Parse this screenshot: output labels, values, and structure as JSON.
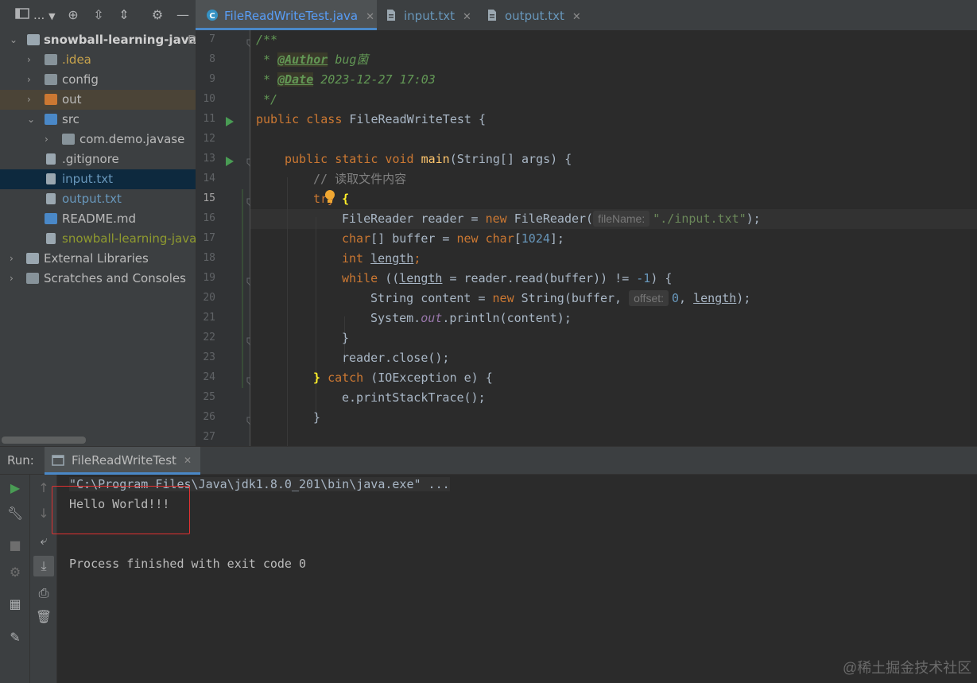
{
  "toolbar": {
    "project_dropdown": "...",
    "icons": [
      "project-view-icon",
      "locate-icon",
      "expand-all-icon",
      "collapse-all-icon",
      "settings-icon",
      "hide-icon"
    ]
  },
  "tabs": [
    {
      "label": "FileReadWriteTest.java",
      "active": true,
      "icon": "java-class-icon"
    },
    {
      "label": "input.txt",
      "active": false,
      "icon": "text-file-icon"
    },
    {
      "label": "output.txt",
      "active": false,
      "icon": "text-file-icon"
    }
  ],
  "tree": {
    "root": "snowball-learning-java",
    "root_suffix": "D",
    "items": [
      {
        "label": ".idea",
        "color": "#c7a34c"
      },
      {
        "label": "config",
        "color": "#bbbbbb"
      },
      {
        "label": "out",
        "color": "#bbbbbb"
      },
      {
        "label": "src",
        "color": "#bbbbbb"
      },
      {
        "label": "com.demo.javase",
        "color": "#bbbbbb"
      },
      {
        "label": ".gitignore",
        "color": "#bbbbbb"
      },
      {
        "label": "input.txt",
        "color": "#6897bb"
      },
      {
        "label": "output.txt",
        "color": "#6897bb"
      },
      {
        "label": "README.md",
        "color": "#bbbbbb"
      },
      {
        "label": "snowball-learning-java.",
        "color": "#8f9a2f"
      },
      {
        "label": "External Libraries",
        "color": "#bbbbbb"
      },
      {
        "label": "Scratches and Consoles",
        "color": "#bbbbbb"
      }
    ]
  },
  "editor": {
    "line_numbers": [
      "7",
      "8",
      "9",
      "10",
      "11",
      "12",
      "13",
      "14",
      "15",
      "16",
      "17",
      "18",
      "19",
      "20",
      "21",
      "22",
      "23",
      "24",
      "25",
      "26",
      "27"
    ],
    "current_line": "15",
    "inline_hints": {
      "filename": "fileName:",
      "offset": "offset:"
    },
    "code": {
      "l7": "/**",
      "l8_prefix": " * ",
      "l8_tag": "@Author",
      "l8_value": " bug菌",
      "l9_prefix": " * ",
      "l9_tag": "@Date",
      "l9_value": " 2023-12-27 17:03",
      "l10": " */",
      "l11_kw": "public class ",
      "l11_rest": "FileReadWriteTest {",
      "l13_kw": "public static void ",
      "l13_fn": "main",
      "l13_rest": "(String[] args) {",
      "l14": "// 读取文件内容",
      "l15_kw": "try ",
      "l15_rest": "{",
      "l16_a": "FileReader reader = ",
      "l16_kw": "new ",
      "l16_b": "FileReader(",
      "l16_str": "\"./input.txt\"",
      "l16_c": ");",
      "l17_kw": "char",
      "l17_a": "[] buffer = ",
      "l17_kw2": "new char",
      "l17_b": "[",
      "l17_num": "1024",
      "l17_c": "];",
      "l18_kw": "int ",
      "l18_var": "length",
      "l18_c": ";",
      "l19_kw": "while ",
      "l19_a": "((",
      "l19_var": "length",
      "l19_b": " = reader.read(buffer)) != ",
      "l19_num": "-1",
      "l19_c": ") {",
      "l20_a": "String content = ",
      "l20_kw": "new ",
      "l20_b": "String(buffer, ",
      "l20_num": "0",
      "l20_c": ", ",
      "l20_var": "length",
      "l20_d": ");",
      "l21_a": "System.",
      "l21_static": "out",
      "l21_b": ".println(content);",
      "l22": "}",
      "l23": "reader.close();",
      "l24_a": "} ",
      "l24_kw": "catch ",
      "l24_b": "(IOException e) {",
      "l25": "e.printStackTrace();",
      "l26": "}"
    }
  },
  "run": {
    "label": "Run:",
    "tab_label": "FileReadWriteTest",
    "console": [
      "\"C:\\Program Files\\Java\\jdk1.8.0_201\\bin\\java.exe\" ...",
      "Hello World!!!",
      "Process finished with exit code 0"
    ]
  },
  "watermark": "@稀土掘金技术社区",
  "colors": {
    "accent": "#4a88c7",
    "highlight_box": "#e03131",
    "run_green": "#499c54"
  }
}
